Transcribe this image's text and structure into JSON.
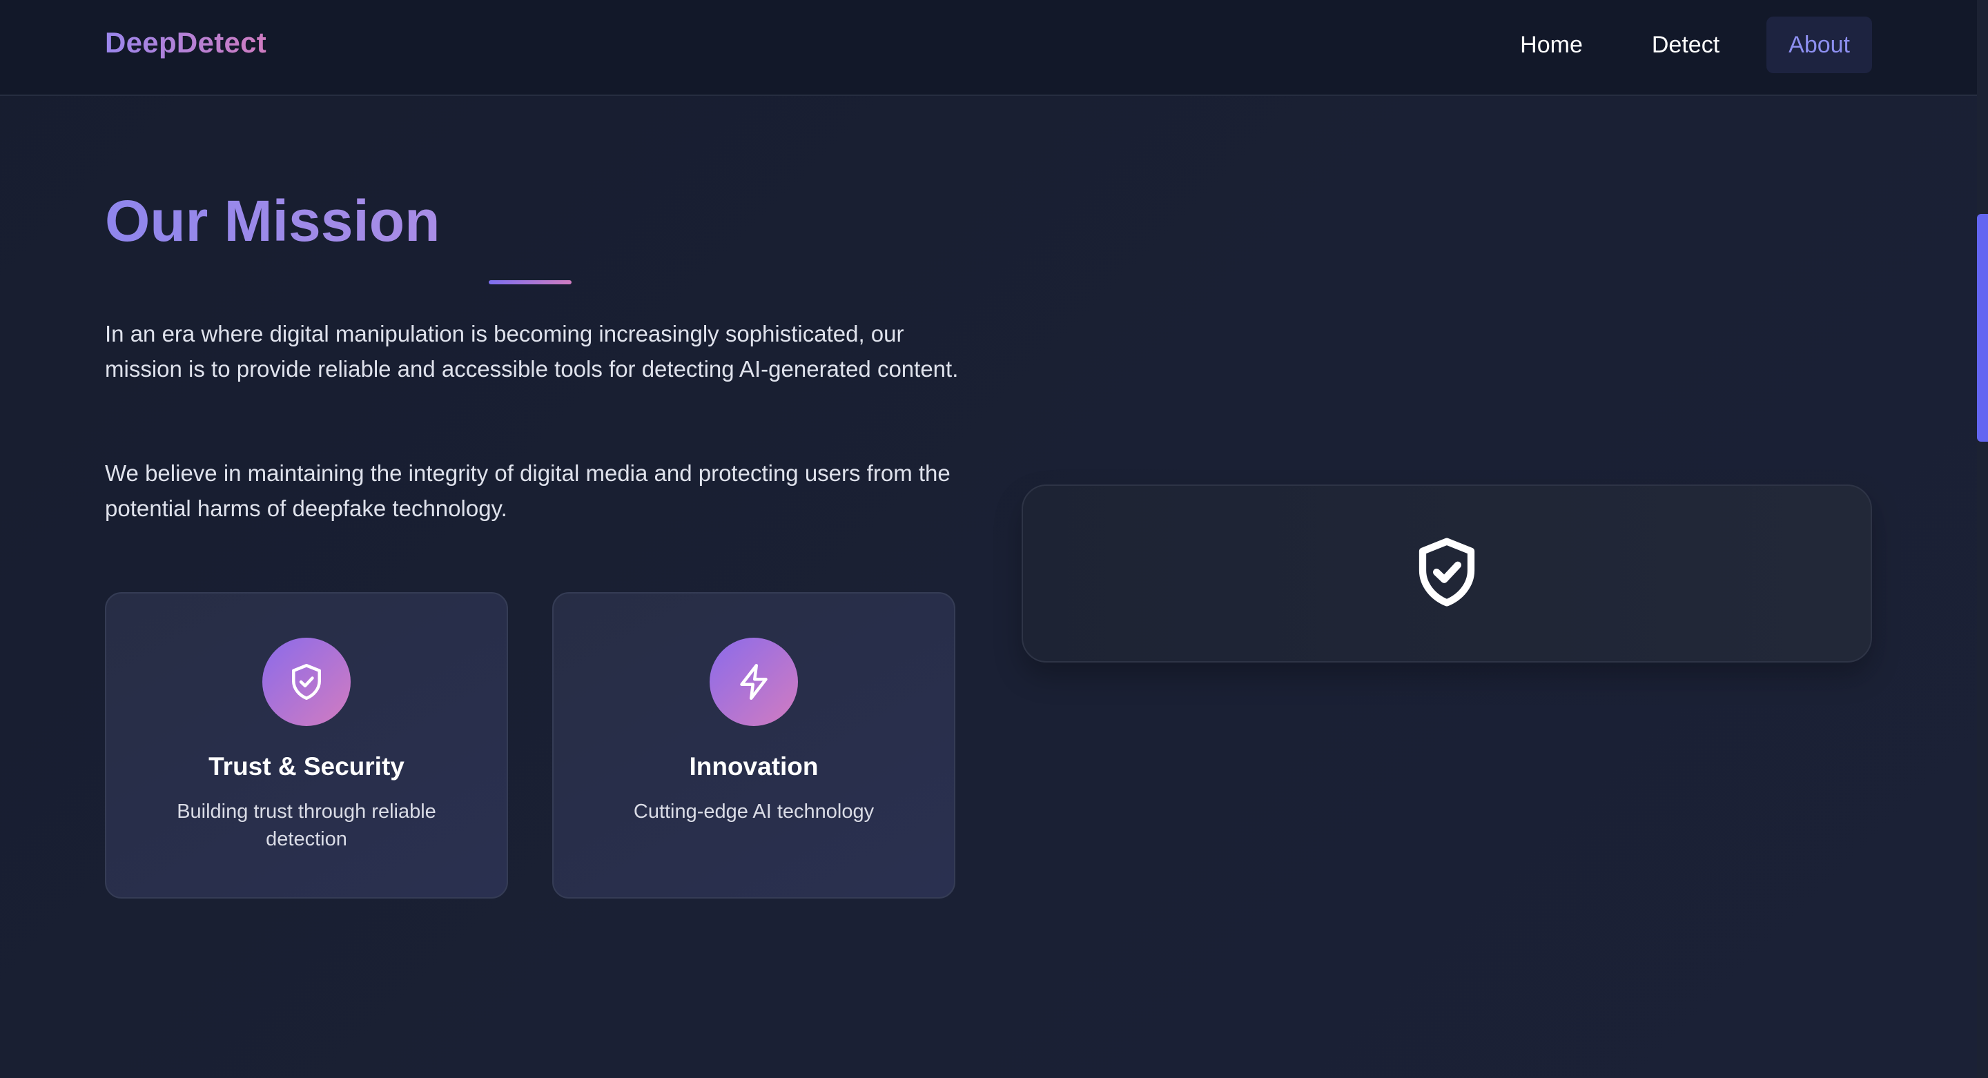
{
  "nav": {
    "brand": "DeepDetect",
    "links": [
      {
        "label": "Home",
        "active": false
      },
      {
        "label": "Detect",
        "active": false
      },
      {
        "label": "About",
        "active": true
      }
    ]
  },
  "mission": {
    "title": "Our Mission",
    "paragraphs": [
      "In an era where digital manipulation is becoming increasingly sophisticated, our mission is to provide reliable and accessible tools for detecting AI-generated content.",
      "We believe in maintaining the integrity of digital media and protecting users from the potential harms of deepfake technology."
    ]
  },
  "features": [
    {
      "icon": "shield-check-icon",
      "title": "Trust & Security",
      "description": "Building trust through reliable detection"
    },
    {
      "icon": "lightning-icon",
      "title": "Innovation",
      "description": "Cutting-edge AI technology"
    }
  ],
  "hero_panel": {
    "icon": "shield-check-icon"
  },
  "colors": {
    "background": "#171d2f",
    "navbar": "#121829",
    "accent": "#8d8ff0",
    "gradient_start": "#8b6bea",
    "gradient_end": "#d27cc0",
    "scroll_thumb": "#6366f1"
  }
}
